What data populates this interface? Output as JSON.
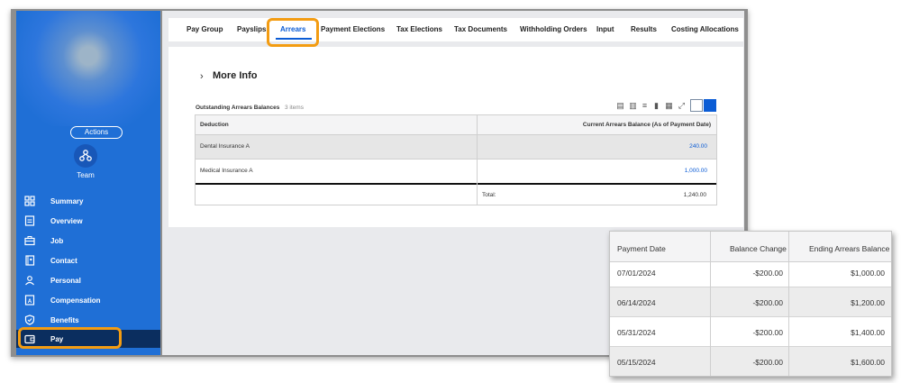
{
  "sidebar": {
    "actions_label": "Actions",
    "team_label": "Team",
    "items": [
      {
        "label": "Summary",
        "icon": "grid-icon"
      },
      {
        "label": "Overview",
        "icon": "doc-icon"
      },
      {
        "label": "Job",
        "icon": "briefcase-icon"
      },
      {
        "label": "Contact",
        "icon": "contact-book-icon"
      },
      {
        "label": "Personal",
        "icon": "person-icon"
      },
      {
        "label": "Compensation",
        "icon": "compensation-icon"
      },
      {
        "label": "Benefits",
        "icon": "shield-icon"
      },
      {
        "label": "Pay",
        "icon": "wallet-icon"
      }
    ]
  },
  "tabs": [
    "Pay Group",
    "Payslips",
    "Arrears",
    "Payment Elections",
    "Tax Elections",
    "Tax Documents",
    "Withholding Orders",
    "Input",
    "Results",
    "Costing Allocations"
  ],
  "more_info": "More Info",
  "grid": {
    "title": "Outstanding Arrears Balances",
    "count": "3 items",
    "columns": [
      "Deduction",
      "Current Arrears Balance (As of Payment Date)"
    ],
    "rows": [
      {
        "deduction": "Dental Insurance A",
        "balance": "240.00"
      },
      {
        "deduction": "Medical Insurance A",
        "balance": "1,000.00"
      }
    ],
    "total_label": "Total:",
    "total_value": "1,240.00"
  },
  "zoom_table": {
    "columns": [
      "Payment Date",
      "Balance Change",
      "Ending Arrears Balance"
    ],
    "rows": [
      {
        "date": "07/01/2024",
        "change": "-$200.00",
        "ending": "$1,000.00"
      },
      {
        "date": "06/14/2024",
        "change": "-$200.00",
        "ending": "$1,200.00"
      },
      {
        "date": "05/31/2024",
        "change": "-$200.00",
        "ending": "$1,400.00"
      },
      {
        "date": "05/15/2024",
        "change": "-$200.00",
        "ending": "$1,600.00"
      }
    ]
  },
  "colors": {
    "sidebar": "#1f6fd6",
    "active_nav": "#0b2e5f",
    "accent": "#0b5cd5",
    "highlight": "#f39c12"
  }
}
